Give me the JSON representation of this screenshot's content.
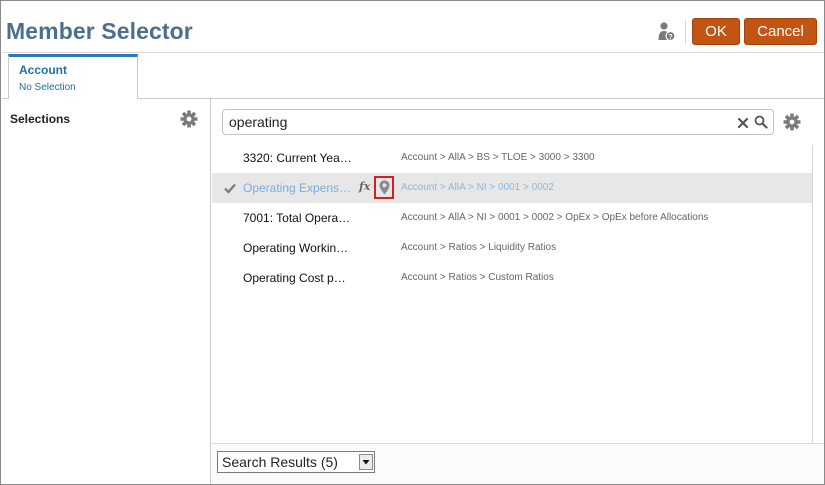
{
  "dialog": {
    "title": "Member Selector",
    "ok_label": "OK",
    "cancel_label": "Cancel",
    "help_icon": "person-help-icon",
    "accent_color": "#c25512",
    "title_color": "#4b6f93"
  },
  "tab": {
    "title": "Account",
    "subtitle": "No Selection"
  },
  "selections_pane": {
    "label": "Selections",
    "settings_icon": "gear-icon"
  },
  "search": {
    "value": "operating",
    "clear_icon": "close-icon",
    "search_icon": "search-icon",
    "settings_icon": "gear-icon"
  },
  "results": [
    {
      "name": "3320: Current Yea…",
      "path": "Account > AllA > BS > TLOE > 3000 > 3300",
      "selected": false
    },
    {
      "name": "Operating Expens…",
      "path": "Account > AllA > NI > 0001 > 0002",
      "selected": true,
      "fx": "fx",
      "locate_icon": "map-pin-icon"
    },
    {
      "name": "7001: Total Opera…",
      "path": "Account > AllA > NI > 0001 > 0002 > OpEx > OpEx before Allocations",
      "selected": false
    },
    {
      "name": "Operating Workin…",
      "path": "Account > Ratios > Liquidity Ratios",
      "selected": false
    },
    {
      "name": "Operating Cost p…",
      "path": "Account > Ratios > Custom Ratios",
      "selected": false
    }
  ],
  "footer": {
    "view_select": "Search Results (5)"
  }
}
